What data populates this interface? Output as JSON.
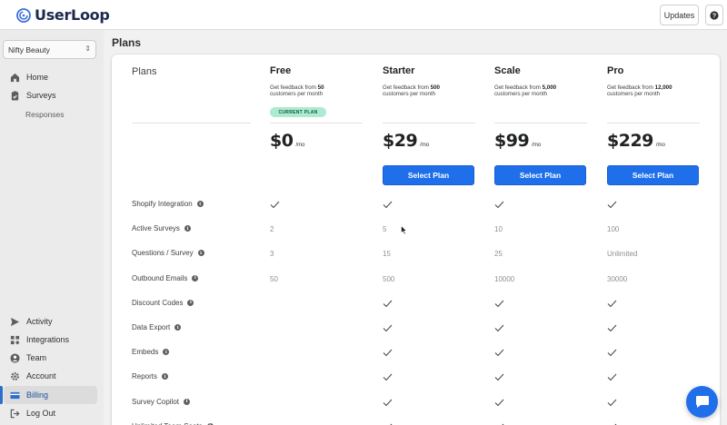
{
  "app": {
    "name": "UserLoop"
  },
  "topbar": {
    "updates_label": "Updates",
    "help_label": "?"
  },
  "sidebar": {
    "store": "Nifty Beauty",
    "top_items": [
      {
        "label": "Home",
        "icon": "home-icon"
      },
      {
        "label": "Surveys",
        "icon": "clipboard-icon"
      }
    ],
    "sub_item": "Responses",
    "bottom_items": [
      {
        "label": "Activity",
        "icon": "send-icon"
      },
      {
        "label": "Integrations",
        "icon": "apps-icon"
      },
      {
        "label": "Team",
        "icon": "user-icon"
      },
      {
        "label": "Account",
        "icon": "gear-icon"
      },
      {
        "label": "Billing",
        "icon": "credit-card-icon",
        "active": true
      },
      {
        "label": "Log Out",
        "icon": "logout-icon"
      }
    ]
  },
  "page": {
    "title": "Plans"
  },
  "plans_header": "Plans",
  "plans": [
    {
      "name": "Free",
      "desc_pre": "Get feedback from",
      "desc_num": "50",
      "desc_post": "customers per month",
      "badge": "CURRENT PLAN",
      "price": "$0",
      "per": "/mo",
      "button": null
    },
    {
      "name": "Starter",
      "desc_pre": "Get feedback from",
      "desc_num": "500",
      "desc_post": "customers per month",
      "badge": null,
      "price": "$29",
      "per": "/mo",
      "button": "Select Plan"
    },
    {
      "name": "Scale",
      "desc_pre": "Get feedback from",
      "desc_num": "5,000",
      "desc_post": "customers per month",
      "badge": null,
      "price": "$99",
      "per": "/mo",
      "button": "Select Plan"
    },
    {
      "name": "Pro",
      "desc_pre": "Get feedback from",
      "desc_num": "12,000",
      "desc_post": "customers per month",
      "badge": null,
      "price": "$229",
      "per": "/mo",
      "button": "Select Plan"
    }
  ],
  "features": [
    {
      "label": "Shopify Integration",
      "values": [
        "check",
        "check",
        "check",
        "check"
      ]
    },
    {
      "label": "Active Surveys",
      "values": [
        "2",
        "5",
        "10",
        "100"
      ]
    },
    {
      "label": "Questions / Survey",
      "values": [
        "3",
        "15",
        "25",
        "Unlimited"
      ]
    },
    {
      "label": "Outbound Emails",
      "values": [
        "50",
        "500",
        "10000",
        "30000"
      ]
    },
    {
      "label": "Discount Codes",
      "values": [
        "",
        "check",
        "check",
        "check"
      ]
    },
    {
      "label": "Data Export",
      "values": [
        "",
        "check",
        "check",
        "check"
      ]
    },
    {
      "label": "Embeds",
      "values": [
        "",
        "check",
        "check",
        "check"
      ]
    },
    {
      "label": "Reports",
      "values": [
        "",
        "check",
        "check",
        "check"
      ]
    },
    {
      "label": "Survey Copilot",
      "values": [
        "",
        "check",
        "check",
        "check"
      ]
    },
    {
      "label": "Unlimited Team Seats",
      "values": [
        "",
        "check",
        "check",
        "check"
      ]
    }
  ],
  "colors": {
    "primary": "#1f6feb",
    "badge_bg": "#aee9d1",
    "active_nav": "#dcdcdc"
  },
  "chat_icon": "chat-bubble-icon"
}
